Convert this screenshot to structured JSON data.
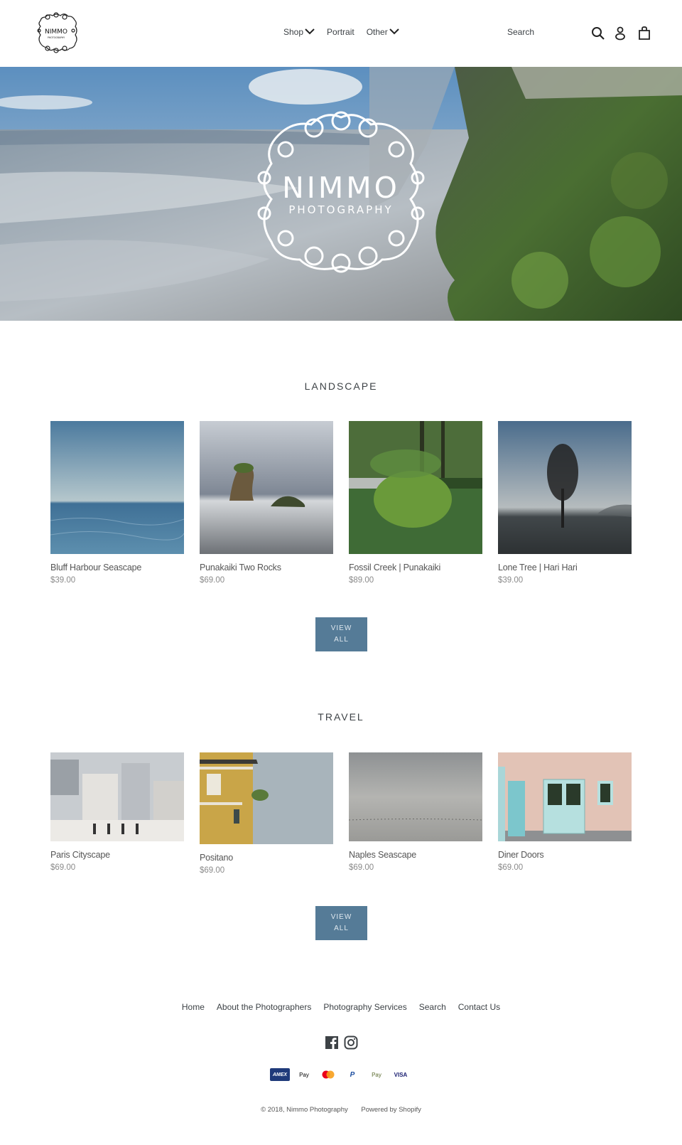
{
  "header": {
    "logo": {
      "title": "NIMMO",
      "subtitle": "PHOTOGRAPHY"
    },
    "nav": [
      {
        "label": "Shop",
        "has_dropdown": true
      },
      {
        "label": "Portrait",
        "has_dropdown": false
      },
      {
        "label": "Other",
        "has_dropdown": true
      }
    ],
    "search_placeholder": "Search",
    "icons": [
      "search-icon",
      "account-icon",
      "cart-icon"
    ]
  },
  "hero": {
    "title": "NIMMO",
    "subtitle": "PHOTOGRAPHY"
  },
  "sections": [
    {
      "title": "LANDSCAPE",
      "products": [
        {
          "name": "Bluff Harbour Seascape",
          "price": "$39.00"
        },
        {
          "name": "Punakaiki Two Rocks",
          "price": "$69.00"
        },
        {
          "name": "Fossil Creek | Punakaiki",
          "price": "$89.00"
        },
        {
          "name": "Lone Tree | Hari Hari",
          "price": "$39.00"
        }
      ],
      "view_all_line1": "VIEW",
      "view_all_line2": "ALL"
    },
    {
      "title": "TRAVEL",
      "products": [
        {
          "name": "Paris Cityscape",
          "price": "$69.00"
        },
        {
          "name": "Positano",
          "price": "$69.00"
        },
        {
          "name": "Naples Seascape",
          "price": "$69.00"
        },
        {
          "name": "Diner Doors",
          "price": "$69.00"
        }
      ],
      "view_all_line1": "VIEW",
      "view_all_line2": "ALL"
    }
  ],
  "footer": {
    "links": [
      "Home",
      "About the Photographers",
      "Photography Services",
      "Search",
      "Contact Us"
    ],
    "social": [
      "facebook-icon",
      "instagram-icon"
    ],
    "payments": [
      {
        "label": "AMEX",
        "bg": "#1f3a7a",
        "fg": "#ffffff"
      },
      {
        "label": "Pay",
        "bg": "#ffffff",
        "fg": "#000000"
      },
      {
        "label": "",
        "bg": "#ffffff",
        "fg": "#000000"
      },
      {
        "label": "P",
        "bg": "#ffffff",
        "fg": "#1f4fa0"
      },
      {
        "label": "Pay",
        "bg": "#ffffff",
        "fg": "#5a6b2e"
      },
      {
        "label": "VISA",
        "bg": "#ffffff",
        "fg": "#1a1f71"
      }
    ],
    "copyright": "© 2018, Nimmo Photography",
    "powered_by": "Powered by Shopify"
  },
  "colors": {
    "accent": "#557b97",
    "text": "#3d4246",
    "muted": "#8a8a8a"
  }
}
